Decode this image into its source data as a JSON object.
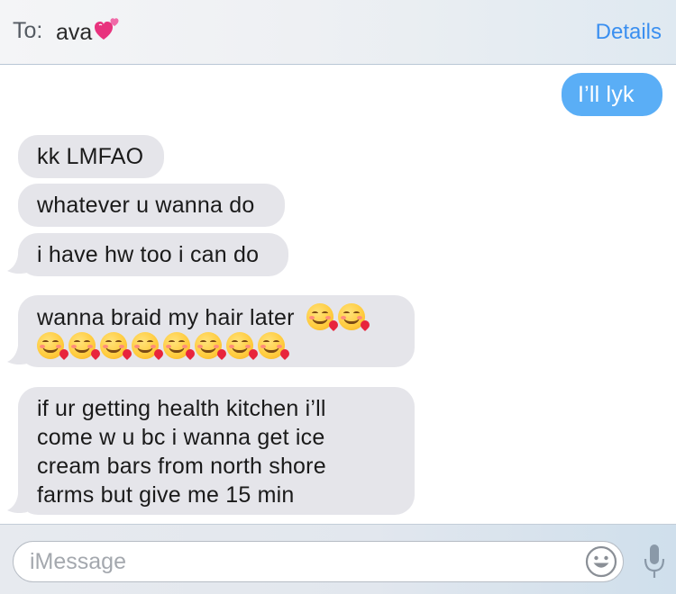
{
  "header": {
    "to_label": "To:",
    "recipient_name": "ava",
    "recipient_emoji_icon": "pink-hearts-icon",
    "details_label": "Details"
  },
  "thread": {
    "sent": [
      {
        "text": "I’ll lyk"
      }
    ],
    "received": [
      {
        "text": "kk LMFAO"
      },
      {
        "text": "whatever u wanna do"
      },
      {
        "text": "i have hw too i can do"
      },
      {
        "text": "wanna braid my hair later",
        "emoji_icon": "smiling-face-with-hearts-icon",
        "emoji_count": 10
      },
      {
        "line1": "if ur getting health kitchen i’ll",
        "line2": "come w u bc i wanna get ice",
        "line3": "cream bars from north shore",
        "line4": "farms but give me 15 min"
      }
    ]
  },
  "input_bar": {
    "placeholder": "iMessage",
    "emoji_button_icon": "emoji-face-icon",
    "mic_button_icon": "microphone-icon"
  },
  "colors": {
    "sent_bubble": "#5aaef6",
    "received_bubble": "#e5e5ea",
    "accent": "#3a8ff0"
  }
}
